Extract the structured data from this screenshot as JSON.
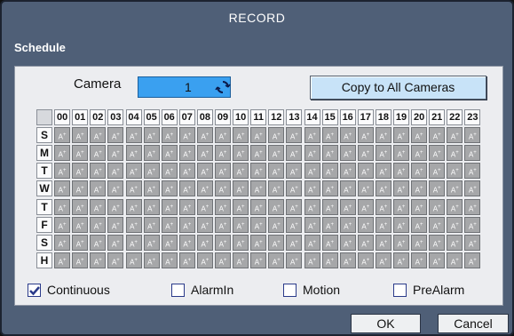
{
  "title": "RECORD",
  "section": "Schedule",
  "camera": {
    "label": "Camera",
    "value": "1"
  },
  "copy_label": "Copy to All Cameras",
  "hours": [
    "00",
    "01",
    "02",
    "03",
    "04",
    "05",
    "06",
    "07",
    "08",
    "09",
    "10",
    "11",
    "12",
    "13",
    "14",
    "15",
    "16",
    "17",
    "18",
    "19",
    "20",
    "21",
    "22",
    "23"
  ],
  "days": [
    "S",
    "M",
    "T",
    "W",
    "T",
    "F",
    "S",
    "H"
  ],
  "cell_text": "A",
  "cell_sup": "+",
  "modes": [
    {
      "label": "Continuous",
      "checked": true
    },
    {
      "label": "AlarmIn",
      "checked": false
    },
    {
      "label": "Motion",
      "checked": false
    },
    {
      "label": "PreAlarm",
      "checked": false
    }
  ],
  "buttons": {
    "ok": "OK",
    "cancel": "Cancel"
  },
  "colors": {
    "dialog": "#4f5f77",
    "field": "#3aa0f0",
    "cell": "#a6a7a9",
    "check": "#2a3a8a"
  }
}
